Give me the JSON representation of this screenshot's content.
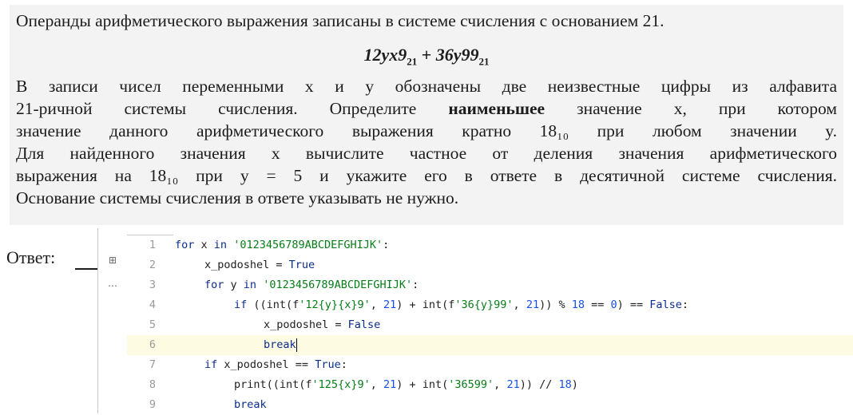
{
  "problem": {
    "line1": "Операнды арифметического выражения записаны в системе счисления с основанием 21.",
    "formula": {
      "term1": "12yx9",
      "term1_base": "21",
      "operator": "+",
      "term2": "36y99",
      "term2_base": "21"
    },
    "para": [
      "В записи чисел переменными x и y обозначены две неизвестные цифры из алфавита",
      "21-ричной системы счисления. Определите наименьшее значение x, при котором",
      "значение данного арифметического выражения кратно 18₁₀ при любом значении y.",
      "Для найденного значения x вычислите частное от деления значения арифметического",
      "выражения на 18₁₀ при y = 5 и укажите его в ответе в десятичной системе счисления.",
      "Основание системы счисления в ответе указывать не нужно."
    ]
  },
  "answer": {
    "label": "Ответ:"
  },
  "editor": {
    "icons": [
      "structure-icon",
      "more-icon"
    ],
    "current_line": 6,
    "lines": [
      {
        "n": "1",
        "indent": 0,
        "text": "for x in '0123456789ABCDEFGHIJK':"
      },
      {
        "n": "2",
        "indent": 1,
        "text": "x_podoshel = True"
      },
      {
        "n": "3",
        "indent": 1,
        "text": "for y in '0123456789ABCDEFGHIJK':"
      },
      {
        "n": "4",
        "indent": 2,
        "text": "if ((int(f'12{y}{x}9', 21) + int(f'36{y}99', 21)) % 18 == 0) == False:"
      },
      {
        "n": "5",
        "indent": 3,
        "text": "x_podoshel = False"
      },
      {
        "n": "6",
        "indent": 3,
        "text": "break"
      },
      {
        "n": "7",
        "indent": 1,
        "text": "if x_podoshel == True:"
      },
      {
        "n": "8",
        "indent": 2,
        "text": "print((int(f'125{x}9', 21) + int('36599', 21)) // 18)"
      },
      {
        "n": "9",
        "indent": 2,
        "text": "break"
      }
    ]
  }
}
